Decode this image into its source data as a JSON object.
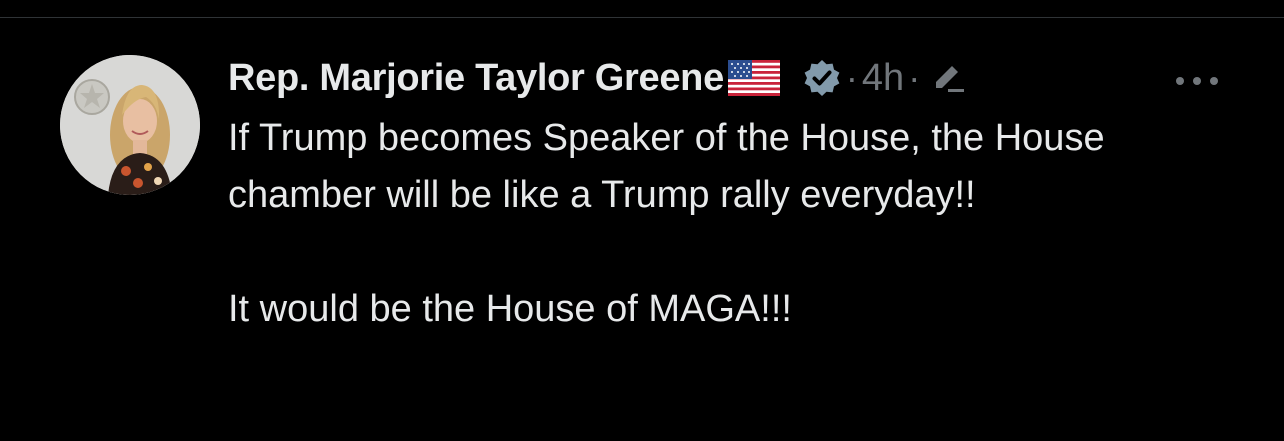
{
  "tweet": {
    "author": {
      "display_name": "Rep. Marjorie Taylor Greene",
      "flag_emoji": "us-flag-icon",
      "verified_icon": "verified-badge-icon",
      "avatar_icon": "avatar"
    },
    "separator_1": "·",
    "timestamp": "4h",
    "separator_2": "·",
    "edited_icon": "edit-pencil-icon",
    "more_icon": "more-options-icon",
    "paragraphs": [
      "If Trump becomes Speaker of the House, the House chamber will be like a Trump rally everyday!!",
      "It would be the House of MAGA!!!"
    ]
  },
  "colors": {
    "background": "#000000",
    "text_primary": "#e7e9ea",
    "text_secondary": "#71767b",
    "divider": "#2f3336",
    "verified_badge": "#829aab"
  }
}
